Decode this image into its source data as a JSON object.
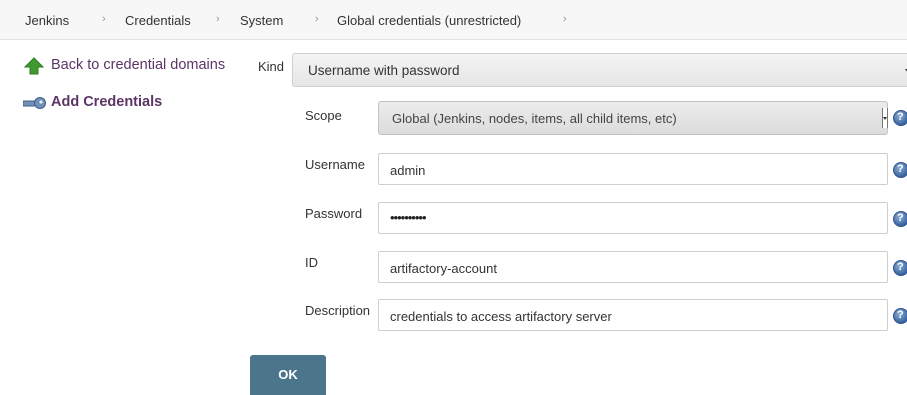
{
  "breadcrumb": [
    "Jenkins",
    "Credentials",
    "System",
    "Global credentials (unrestricted)"
  ],
  "sidebar": {
    "back_label": "Back to credential domains",
    "add_label": "Add Credentials"
  },
  "form": {
    "kind_label": "Kind",
    "kind_value": "Username with password",
    "scope_label": "Scope",
    "scope_value": "Global (Jenkins, nodes, items, all child items, etc)",
    "username_label": "Username",
    "username_value": "admin",
    "password_label": "Password",
    "password_mask": "••••••••••",
    "id_label": "ID",
    "id_value": "artifactory-account",
    "description_label": "Description",
    "description_value": "credentials to access artifactory server",
    "help_glyph": "?",
    "ok_label": "OK"
  },
  "icons": {
    "back": "green-up-arrow-icon",
    "add": "key-icon",
    "help": "help-icon",
    "separator": "›"
  },
  "colors": {
    "link": "#5c3566",
    "ok_button": "#4b758b",
    "help": "#3a64a0"
  }
}
